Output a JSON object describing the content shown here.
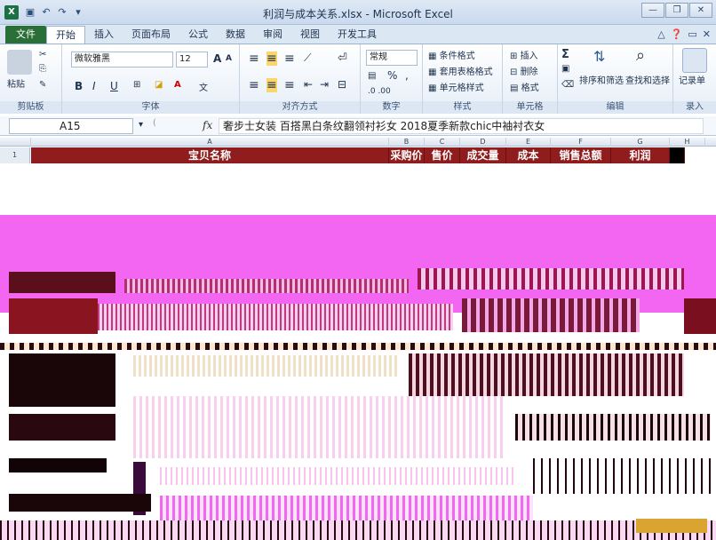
{
  "window": {
    "title": "利润与成本关系.xlsx - Microsoft Excel",
    "app_icon": "X",
    "quick_access": [
      "save-icon",
      "undo-icon",
      "redo-icon",
      "customize-icon"
    ],
    "controls": [
      "minimize",
      "restore",
      "close"
    ]
  },
  "ribbon": {
    "tabs": [
      "文件",
      "开始",
      "插入",
      "页面布局",
      "公式",
      "数据",
      "审阅",
      "视图",
      "开发工具"
    ],
    "active_tab": "开始",
    "groups": {
      "clipboard": {
        "label": "剪贴板",
        "paste": "粘贴"
      },
      "font": {
        "label": "字体",
        "font_name": "微软雅黑",
        "font_size": "12",
        "bold": "B",
        "italic": "I",
        "underline": "U",
        "grow": "A",
        "shrink": "A"
      },
      "alignment": {
        "label": "对齐方式"
      },
      "number": {
        "label": "数字",
        "format": "常规",
        "percent": "%",
        "comma": ","
      },
      "styles": {
        "label": "样式",
        "conditional": "条件格式",
        "table": "套用表格格式",
        "cell": "单元格样式"
      },
      "cells": {
        "label": "单元格",
        "insert": "插入",
        "delete": "删除",
        "format": "格式"
      },
      "editing": {
        "label": "编辑",
        "sort": "排序和筛选",
        "find": "查找和选择",
        "sigma": "Σ"
      },
      "record": {
        "label": "录入",
        "form": "记录单"
      }
    }
  },
  "formula_bar": {
    "name_box": "A15",
    "fx": "fx",
    "content": "奢步士女装 百搭黑白条纹翻领衬衫女 2018夏季新款chic中袖衬衣女"
  },
  "grid": {
    "columns": [
      "A",
      "B",
      "C",
      "D",
      "E",
      "F",
      "G",
      "H"
    ],
    "row_1_label": "1",
    "header_cells": [
      "宝贝名称",
      "采购价",
      "售价",
      "成交量",
      "成本",
      "销售总额",
      "利润"
    ]
  },
  "colors": {
    "header_fill": "#8f1d1d",
    "glitch_magenta": "#f266f2",
    "glitch_dark": "#5a0f1a",
    "file_tab": "#2a6f37"
  }
}
